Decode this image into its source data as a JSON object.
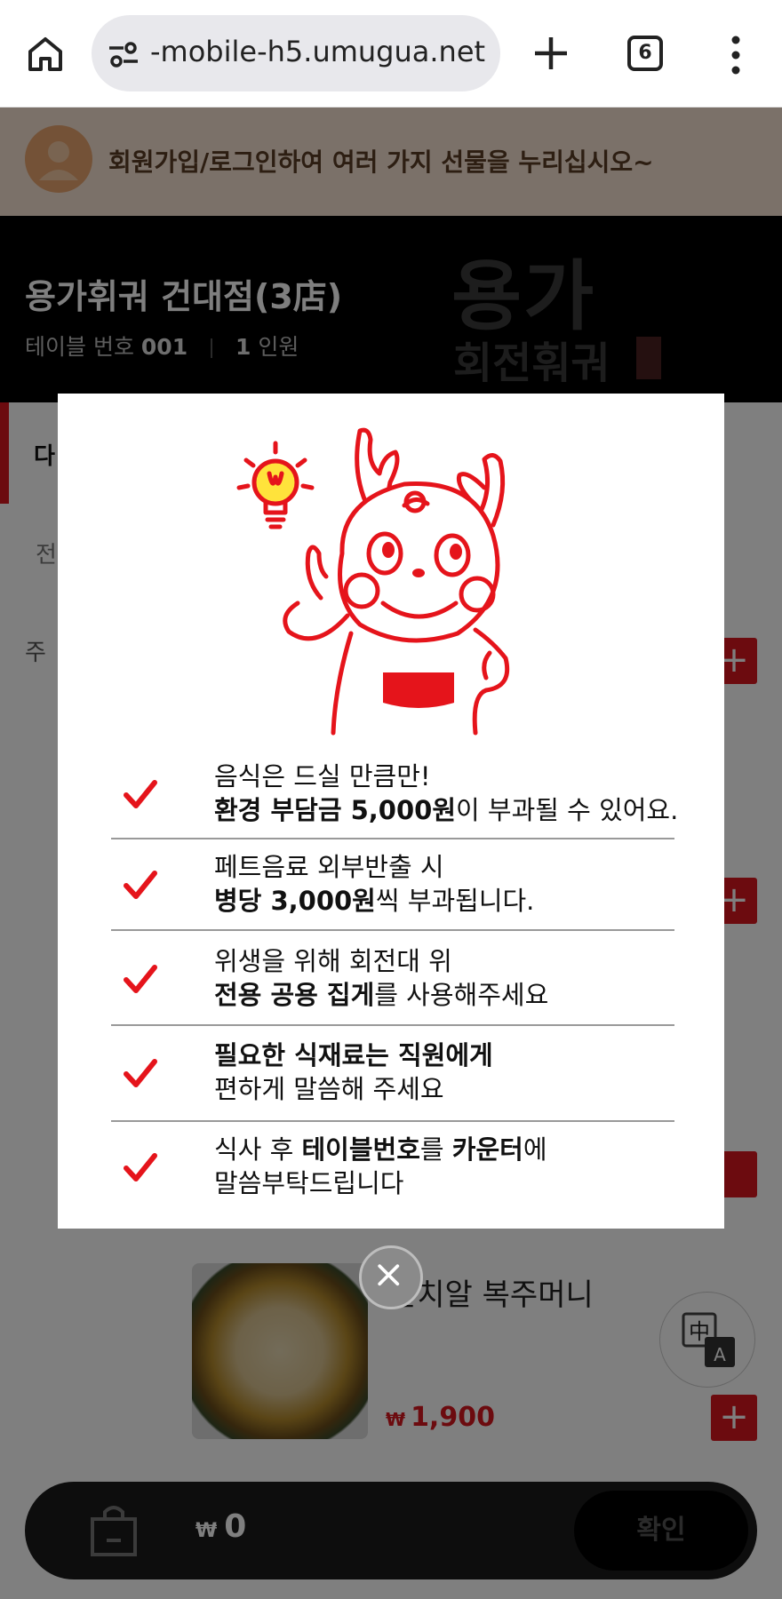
{
  "browser": {
    "url": "-mobile-h5.umugua.net",
    "tab_count": "6"
  },
  "banner": {
    "text": "회원가입/로그인하여 여러 가지 선물을 누리십시오~"
  },
  "store": {
    "name": "용가휘궈 건대점(3店)",
    "table_label": "테이블 번호",
    "table_number": "001",
    "people_count": "1",
    "people_label": "인원",
    "logo_main": "용가",
    "logo_sub": "회전훠궈"
  },
  "sidebar": {
    "item_a": "다",
    "item_b": "전",
    "item_c": "주"
  },
  "menu_item": {
    "name": "알치알 복주머니",
    "price_symbol": "₩",
    "price": "1,900"
  },
  "cart": {
    "currency": "₩",
    "total": "0",
    "confirm_label": "확인"
  },
  "notice": {
    "rules": [
      {
        "line1": "음식은 드실 만큼만!",
        "line2_bold": "환경 부담금 5,000원",
        "line2_rest": "이 부과될 수 있어요."
      },
      {
        "line1": "페트음료 외부반출 시",
        "line2_bold": "병당 3,000원",
        "line2_rest": "씩 부과됩니다."
      },
      {
        "line1": "위생을 위해 회전대 위",
        "line2_bold": "전용 공용 집게",
        "line2_rest": "를 사용해주세요"
      },
      {
        "line1_bold": "필요한 식재료는 직원에게",
        "line2": "편하게 말씀해 주세요"
      },
      {
        "line1_pre": "식사 후 ",
        "line1_bold1": "테이블번호",
        "line1_mid": "를 ",
        "line1_bold2": "카운터",
        "line1_post": "에",
        "line2": "말씀부탁드립니다"
      }
    ]
  },
  "colors": {
    "accent_red": "#d8161f",
    "overlay": "rgba(0,0,0,0.5)"
  },
  "icons": {
    "home": "home-icon",
    "site_settings": "tune-icon",
    "new_tab": "plus-icon",
    "tabs": "tab-switcher-icon",
    "menu": "more-vert-icon",
    "check": "check-icon",
    "close": "close-icon",
    "bag": "shopping-bag-icon",
    "translate": "translate-icon"
  }
}
